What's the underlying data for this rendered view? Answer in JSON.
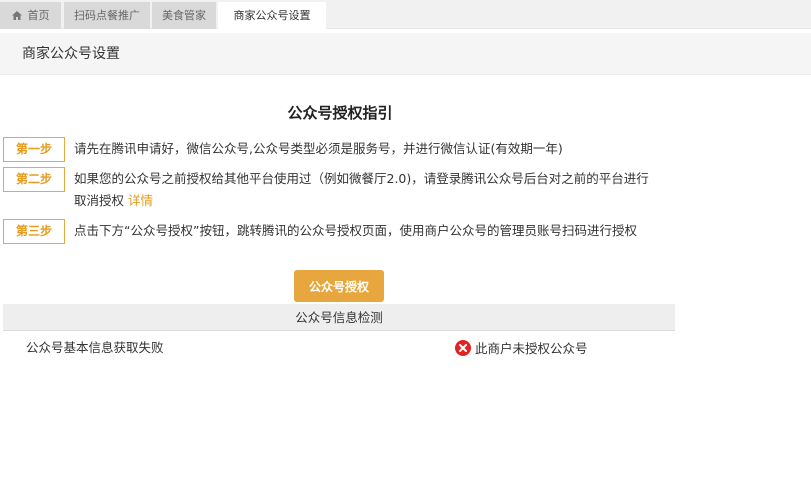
{
  "tabs": [
    {
      "label": "首页",
      "icon": "home-icon"
    },
    {
      "label": "扫码点餐推广"
    },
    {
      "label": "美食管家"
    },
    {
      "label": "商家公众号设置",
      "active": true
    }
  ],
  "header": {
    "title": "商家公众号设置"
  },
  "guide": {
    "title": "公众号授权指引",
    "steps": [
      {
        "badge": "第一步",
        "text": "请先在腾讯申请好，微信公众号,公众号类型必须是服务号，并进行微信认证(有效期一年)"
      },
      {
        "badge": "第二步",
        "text": "如果您的公众号之前授权给其他平台使用过（例如微餐厅2.0)，请登录腾讯公众号后台对之前的平台进行取消授权",
        "link": "详情"
      },
      {
        "badge": "第三步",
        "text": "点击下方“公众号授权”按钮，跳转腾讯的公众号授权页面，使用商户公众号的管理员账号扫码进行授权"
      }
    ],
    "button_label": "公众号授权"
  },
  "check": {
    "title": "公众号信息检测",
    "info_label": "公众号基本信息获取失败",
    "status_text": "此商户未授权公众号",
    "status_icon": "error-icon",
    "status_color": "#e02424"
  },
  "colors": {
    "accent": "#e8a63f",
    "badge_text": "#e69a1e"
  }
}
